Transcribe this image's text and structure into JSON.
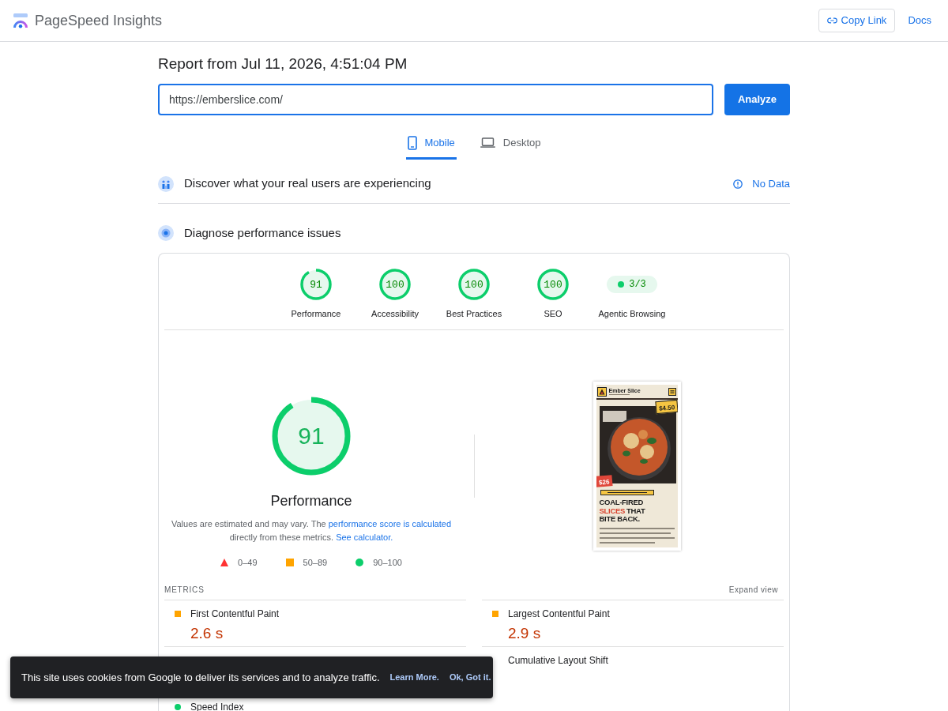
{
  "header": {
    "title": "PageSpeed Insights",
    "buttons": [
      {
        "label": "Copy Link",
        "kind": "outlined"
      },
      {
        "label": "Docs",
        "kind": "text"
      }
    ]
  },
  "report": {
    "title": "Report from Jul 11, 2026, 4:51:04 PM",
    "url_field": {
      "value": "https://emberslice.com/"
    },
    "analyze_button": "Analyze"
  },
  "tabs": [
    {
      "label": "Mobile",
      "selected": true
    },
    {
      "label": "Desktop",
      "selected": false
    }
  ],
  "sections": [
    {
      "title": "Discover what your real users are experiencing",
      "status": "No Data"
    },
    {
      "title": "Diagnose performance issues"
    }
  ],
  "categories": [
    {
      "kind": "gauge",
      "label": "Performance",
      "score": "91"
    },
    {
      "kind": "gauge",
      "label": "Accessibility",
      "score": "100"
    },
    {
      "kind": "gauge",
      "label": "Best Practices",
      "score": "100"
    },
    {
      "kind": "gauge",
      "label": "SEO",
      "score": "100"
    },
    {
      "kind": "pill",
      "label": "Agentic Browsing",
      "score": "3/3"
    }
  ],
  "performance": {
    "score": "91",
    "title": "Performance",
    "description": [
      {
        "kind": "text",
        "text": "Values are estimated and may vary. The "
      },
      {
        "kind": "link",
        "text": "performance score is calculated"
      },
      {
        "kind": "text",
        "text": " directly from these metrics. "
      },
      {
        "kind": "link",
        "text": "See calculator."
      }
    ],
    "legend": [
      {
        "kind": "fail",
        "label": "0–49"
      },
      {
        "kind": "average",
        "label": "50–89"
      },
      {
        "kind": "pass",
        "label": "90–100"
      }
    ],
    "screenshot": {
      "brand": "Ember Slice",
      "price_tag": "$4.50",
      "deal_tag": "$26",
      "headline_lines": [
        [
          {
            "kind": "plain",
            "text": "COAL-FIRED"
          }
        ],
        [
          {
            "kind": "accent",
            "text": "SLICES"
          },
          {
            "kind": "plain",
            "text": "THAT"
          }
        ],
        [
          {
            "kind": "plain",
            "text": "BITE BACK."
          }
        ]
      ]
    }
  },
  "metrics": {
    "title": "METRICS",
    "toggle": "Expand view",
    "rows": [
      {
        "left": {
          "label": "First Contentful Paint",
          "value": "2.6 s",
          "kind": "average"
        },
        "right": {
          "label": "Largest Contentful Paint",
          "value": "2.9 s",
          "kind": "average"
        }
      },
      {
        "right": {
          "label": "Cumulative Layout Shift"
        }
      },
      {
        "left": {
          "label": "Speed Index",
          "kind": "pass"
        }
      }
    ]
  },
  "cookie_banner": {
    "message": "This site uses cookies from Google to deliver its services and to analyze traffic.",
    "actions": [
      "Learn More.",
      "Ok, Got it."
    ]
  }
}
